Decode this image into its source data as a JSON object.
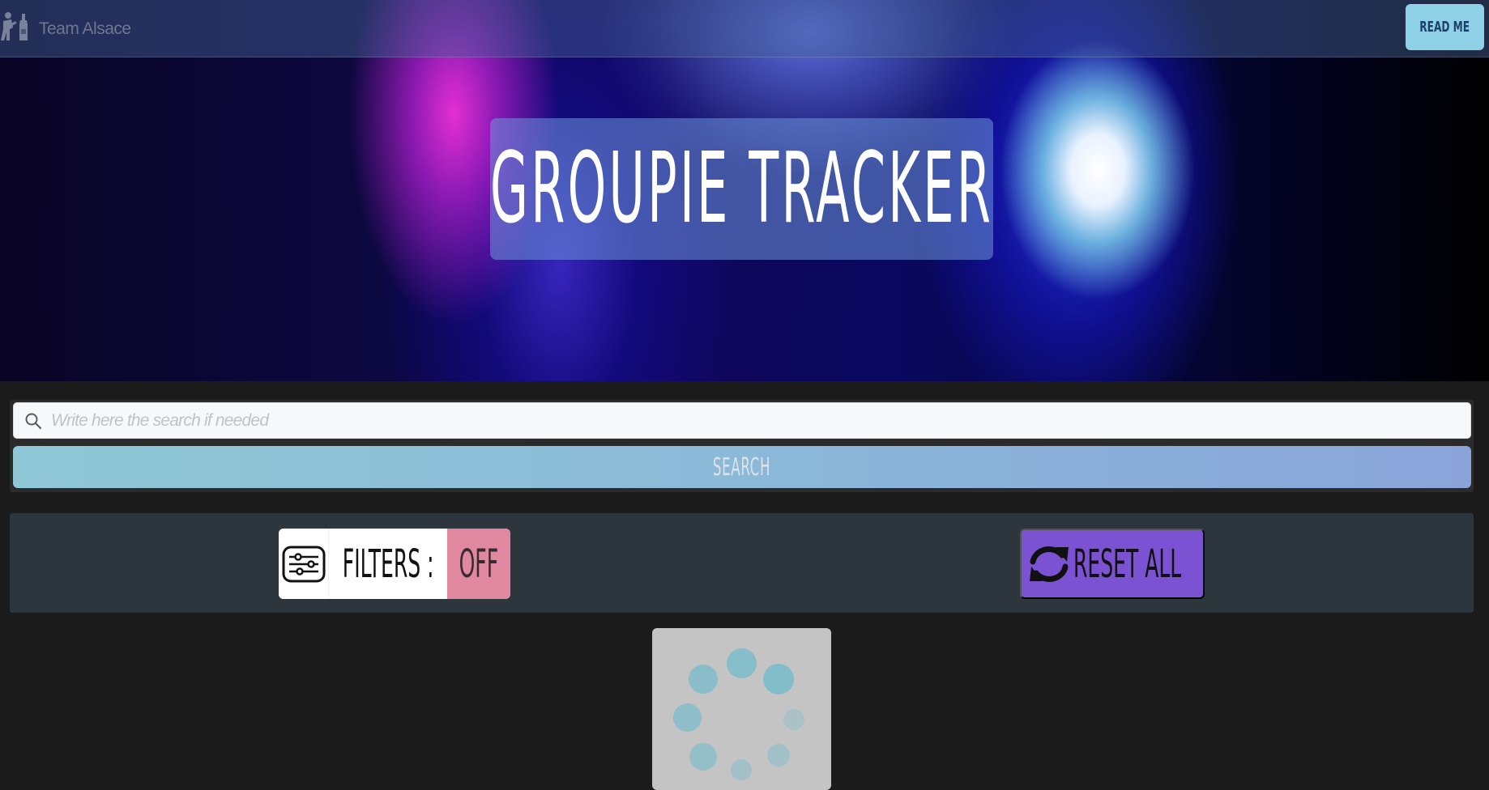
{
  "header": {
    "team_name": "Team Alsace",
    "readme_label": "READ ME",
    "logo_icon": "guitarist-bottle-icon"
  },
  "hero": {
    "title": "GROUPIE TRACKER"
  },
  "search": {
    "placeholder": "Write here the search if needed",
    "value": "",
    "button_label": "SEARCH"
  },
  "filters": {
    "label": "FILTERS :",
    "state": "OFF",
    "icon": "sliders-icon"
  },
  "reset": {
    "label": "RESET ALL",
    "icon": "refresh-icon"
  },
  "loader": {
    "icon": "spinner-dots-icon"
  },
  "colors": {
    "page_bg": "#1b1b1b",
    "readme_bg": "#8ed0e6",
    "filters_state_bg": "#e0889f",
    "reset_bg": "#7b52d2",
    "spinner_dot": "#7bbccb"
  }
}
